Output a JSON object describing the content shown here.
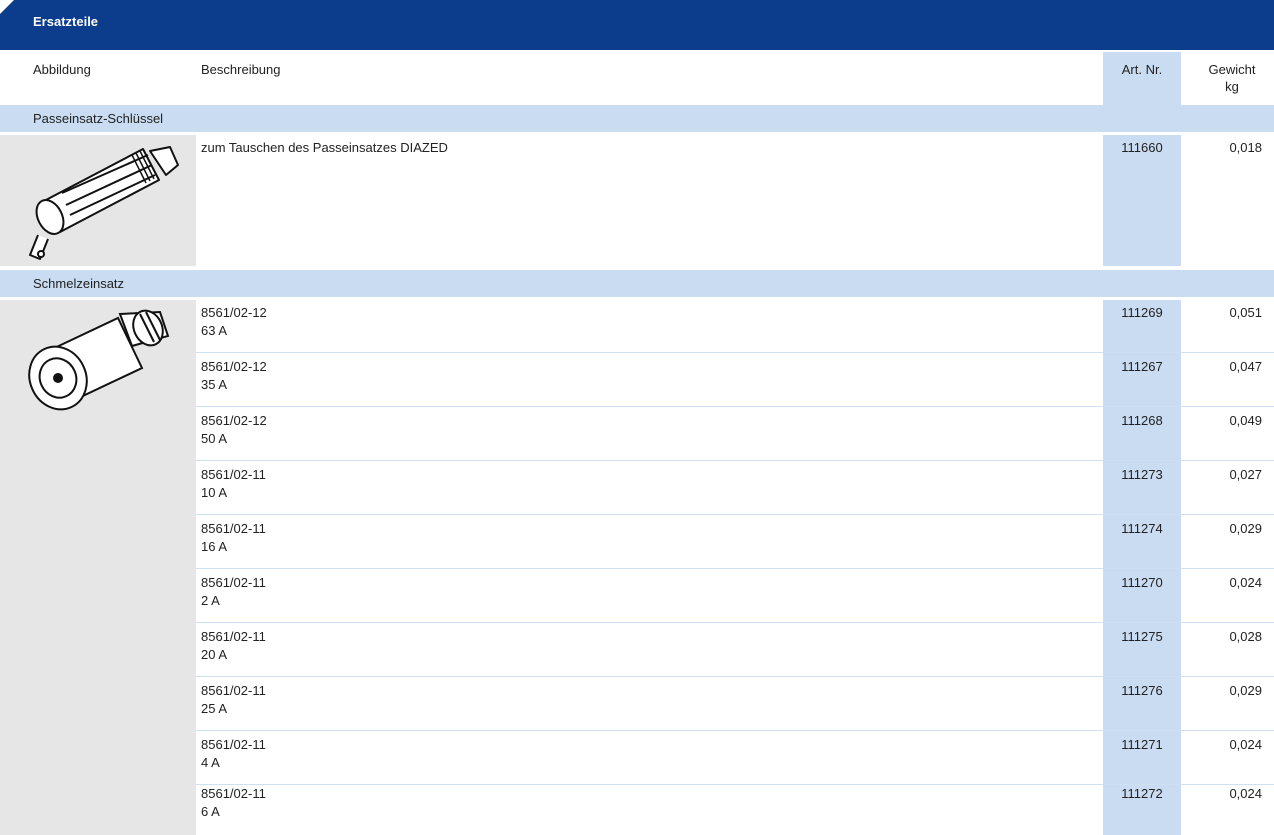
{
  "banner": {
    "title": "Ersatzteile"
  },
  "columns": {
    "image": "Abbildung",
    "description": "Beschreibung",
    "art_nr": "Art. Nr.",
    "weight": "Gewicht",
    "weight_unit": "kg"
  },
  "sections": [
    {
      "label": "Passeinsatz-Schlüssel",
      "image_icon": "passeinsatz-key-drawing",
      "rows": [
        {
          "line1": "zum Tauschen des Passeinsatzes DIAZED",
          "line2": "",
          "art_nr": "111660",
          "weight": "0,018"
        }
      ]
    },
    {
      "label": "Schmelzeinsatz",
      "image_icon": "fuse-cartridge-drawing",
      "rows": [
        {
          "line1": "8561/02-12",
          "line2": "63 A",
          "art_nr": "111269",
          "weight": "0,051"
        },
        {
          "line1": "8561/02-12",
          "line2": "35 A",
          "art_nr": "111267",
          "weight": "0,047"
        },
        {
          "line1": "8561/02-12",
          "line2": "50 A",
          "art_nr": "111268",
          "weight": "0,049"
        },
        {
          "line1": "8561/02-11",
          "line2": "10 A",
          "art_nr": "111273",
          "weight": "0,027"
        },
        {
          "line1": "8561/02-11",
          "line2": "16 A",
          "art_nr": "111274",
          "weight": "0,029"
        },
        {
          "line1": "8561/02-11",
          "line2": "2 A",
          "art_nr": "111270",
          "weight": "0,024"
        },
        {
          "line1": "8561/02-11",
          "line2": "20 A",
          "art_nr": "111275",
          "weight": "0,028"
        },
        {
          "line1": "8561/02-11",
          "line2": "25 A",
          "art_nr": "111276",
          "weight": "0,029"
        },
        {
          "line1": "8561/02-11",
          "line2": "4 A",
          "art_nr": "111271",
          "weight": "0,024"
        },
        {
          "line1": "8561/02-11",
          "line2": "6 A",
          "art_nr": "111272",
          "weight": "0,024"
        }
      ]
    }
  ]
}
